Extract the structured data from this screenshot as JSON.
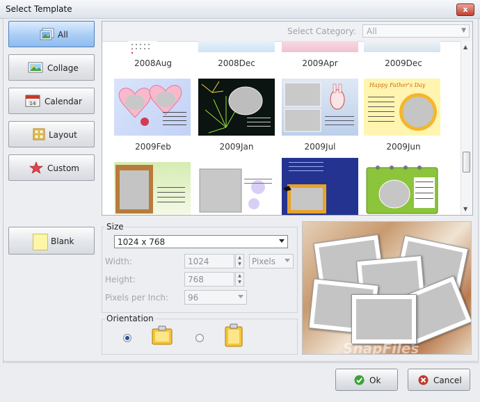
{
  "window": {
    "title": "Select Template",
    "close_glyph": "x"
  },
  "sidebar": {
    "items": [
      {
        "label": "All",
        "icon": "photos-icon",
        "active": true
      },
      {
        "label": "Collage",
        "icon": "picture-icon",
        "active": false
      },
      {
        "label": "Calendar",
        "icon": "calendar-icon",
        "active": false
      },
      {
        "label": "Layout",
        "icon": "grid-icon",
        "active": false
      },
      {
        "label": "Custom",
        "icon": "star-icon",
        "active": false
      }
    ],
    "blank_label": "Blank"
  },
  "gallery": {
    "category_label": "Select Category:",
    "category_value": "All",
    "rows": [
      [
        "2008Aug",
        "2008Dec",
        "2009Apr",
        "2009Dec"
      ],
      [
        "2009Feb",
        "2009Jan",
        "2009Jul",
        "2009Jun"
      ],
      []
    ]
  },
  "size": {
    "group_label": "Size",
    "preset": "1024 x 768",
    "width_label": "Width:",
    "width_value": "1024",
    "unit": "Pixels",
    "height_label": "Height:",
    "height_value": "768",
    "ppi_label": "Pixels per Inch:",
    "ppi_value": "96"
  },
  "orientation": {
    "group_label": "Orientation",
    "selected": "landscape"
  },
  "preview": {
    "watermark": "SnapFiles"
  },
  "buttons": {
    "ok": "Ok",
    "cancel": "Cancel"
  },
  "colors": {
    "accent": "#a9cdf5",
    "ok_icon": "#3aa336",
    "cancel_icon": "#c0392b"
  }
}
